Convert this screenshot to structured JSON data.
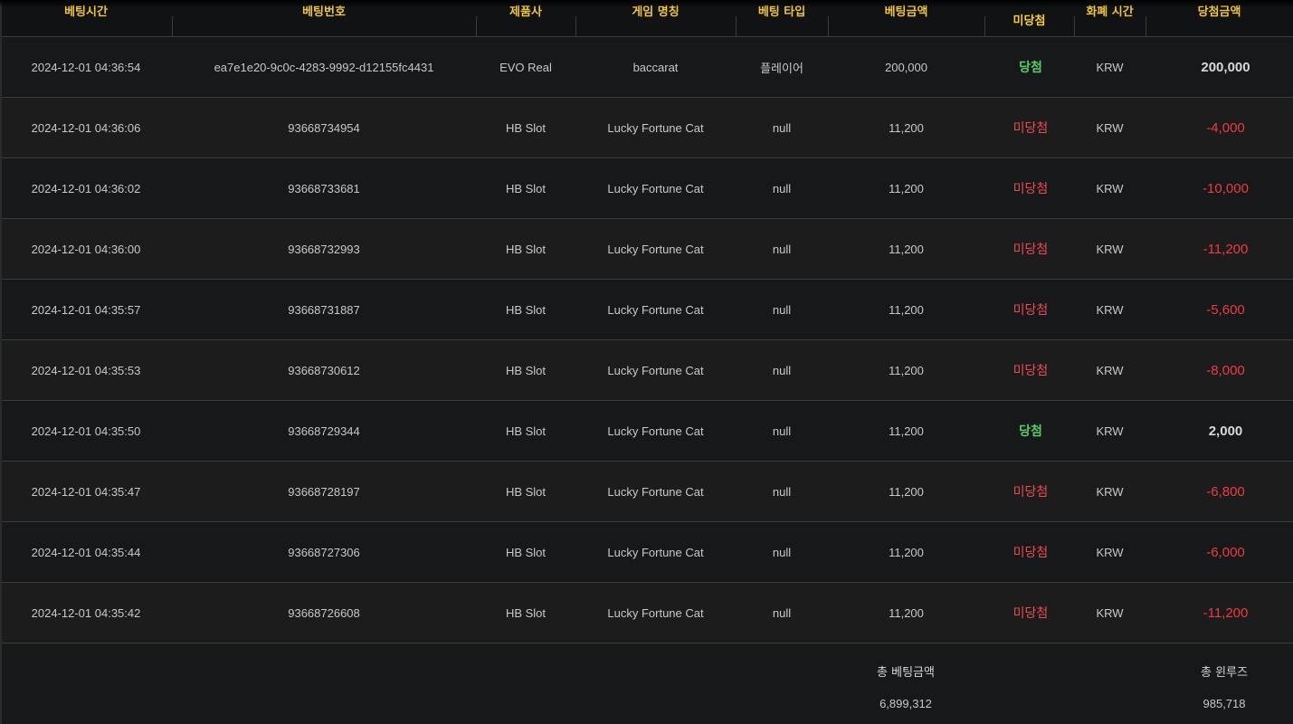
{
  "table": {
    "headers": {
      "bet_time": "베팅시간",
      "bet_id": "베팅번호",
      "provider": "제품사",
      "game_name": "게임 명칭",
      "bet_type": "베팅 타입",
      "bet_amount": "베팅금액",
      "result": "미당첨",
      "currency": "화폐 시간",
      "win_amount": "당첨금액"
    },
    "rows": [
      {
        "time": "2024-12-01 04:36:54",
        "id": "ea7e1e20-9c0c-4283-9992-d12155fc4431",
        "provider": "EVO Real",
        "game": "baccarat",
        "type": "플레이어",
        "bet": "200,000",
        "result": "당첨",
        "currency": "KRW",
        "win": "200,000",
        "status": "win"
      },
      {
        "time": "2024-12-01 04:36:06",
        "id": "93668734954",
        "provider": "HB Slot",
        "game": "Lucky Fortune Cat",
        "type": "null",
        "bet": "11,200",
        "result": "미당첨",
        "currency": "KRW",
        "win": "-4,000",
        "status": "lose"
      },
      {
        "time": "2024-12-01 04:36:02",
        "id": "93668733681",
        "provider": "HB Slot",
        "game": "Lucky Fortune Cat",
        "type": "null",
        "bet": "11,200",
        "result": "미당첨",
        "currency": "KRW",
        "win": "-10,000",
        "status": "lose"
      },
      {
        "time": "2024-12-01 04:36:00",
        "id": "93668732993",
        "provider": "HB Slot",
        "game": "Lucky Fortune Cat",
        "type": "null",
        "bet": "11,200",
        "result": "미당첨",
        "currency": "KRW",
        "win": "-11,200",
        "status": "lose"
      },
      {
        "time": "2024-12-01 04:35:57",
        "id": "93668731887",
        "provider": "HB Slot",
        "game": "Lucky Fortune Cat",
        "type": "null",
        "bet": "11,200",
        "result": "미당첨",
        "currency": "KRW",
        "win": "-5,600",
        "status": "lose"
      },
      {
        "time": "2024-12-01 04:35:53",
        "id": "93668730612",
        "provider": "HB Slot",
        "game": "Lucky Fortune Cat",
        "type": "null",
        "bet": "11,200",
        "result": "미당첨",
        "currency": "KRW",
        "win": "-8,000",
        "status": "lose"
      },
      {
        "time": "2024-12-01 04:35:50",
        "id": "93668729344",
        "provider": "HB Slot",
        "game": "Lucky Fortune Cat",
        "type": "null",
        "bet": "11,200",
        "result": "당첨",
        "currency": "KRW",
        "win": "2,000",
        "status": "win"
      },
      {
        "time": "2024-12-01 04:35:47",
        "id": "93668728197",
        "provider": "HB Slot",
        "game": "Lucky Fortune Cat",
        "type": "null",
        "bet": "11,200",
        "result": "미당첨",
        "currency": "KRW",
        "win": "-6,800",
        "status": "lose"
      },
      {
        "time": "2024-12-01 04:35:44",
        "id": "93668727306",
        "provider": "HB Slot",
        "game": "Lucky Fortune Cat",
        "type": "null",
        "bet": "11,200",
        "result": "미당첨",
        "currency": "KRW",
        "win": "-6,000",
        "status": "lose"
      },
      {
        "time": "2024-12-01 04:35:42",
        "id": "93668726608",
        "provider": "HB Slot",
        "game": "Lucky Fortune Cat",
        "type": "null",
        "bet": "11,200",
        "result": "미당첨",
        "currency": "KRW",
        "win": "-11,200",
        "status": "lose"
      }
    ]
  },
  "summary": {
    "total_bet_label": "총 베팅금액",
    "total_bet_value": "6,899,312",
    "total_winloss_label": "총 윈루즈",
    "total_winloss_value": "985,718"
  },
  "colors": {
    "header_text": "#f0c53c",
    "win": "#56cc6a",
    "lose": "#ee4b52"
  }
}
